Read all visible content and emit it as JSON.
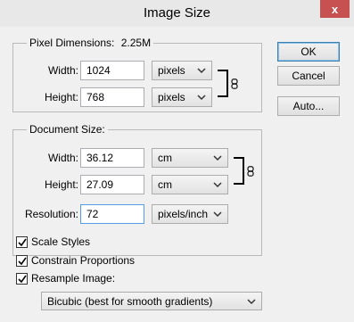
{
  "window": {
    "title": "Image Size",
    "close_glyph": "x"
  },
  "pixel_dimensions": {
    "label": "Pixel Dimensions:",
    "size": "2.25M",
    "width_label": "Width:",
    "width_value": "1024",
    "width_unit": "pixels",
    "height_label": "Height:",
    "height_value": "768",
    "height_unit": "pixels"
  },
  "document_size": {
    "label": "Document Size:",
    "width_label": "Width:",
    "width_value": "36.12",
    "width_unit": "cm",
    "height_label": "Height:",
    "height_value": "27.09",
    "height_unit": "cm",
    "resolution_label": "Resolution:",
    "resolution_value": "72",
    "resolution_unit": "pixels/inch"
  },
  "buttons": {
    "ok": "OK",
    "cancel": "Cancel",
    "auto": "Auto..."
  },
  "options": {
    "scale_styles": "Scale Styles",
    "constrain_proportions": "Constrain Proportions",
    "resample_image": "Resample Image:",
    "resample_method": "Bicubic (best for smooth gradients)"
  },
  "checked": {
    "scale_styles": true,
    "constrain_proportions": true,
    "resample_image": true
  },
  "colors": {
    "close_button": "#c75050",
    "focus_border": "#569de5",
    "default_button_border": "#3c7fb1"
  }
}
